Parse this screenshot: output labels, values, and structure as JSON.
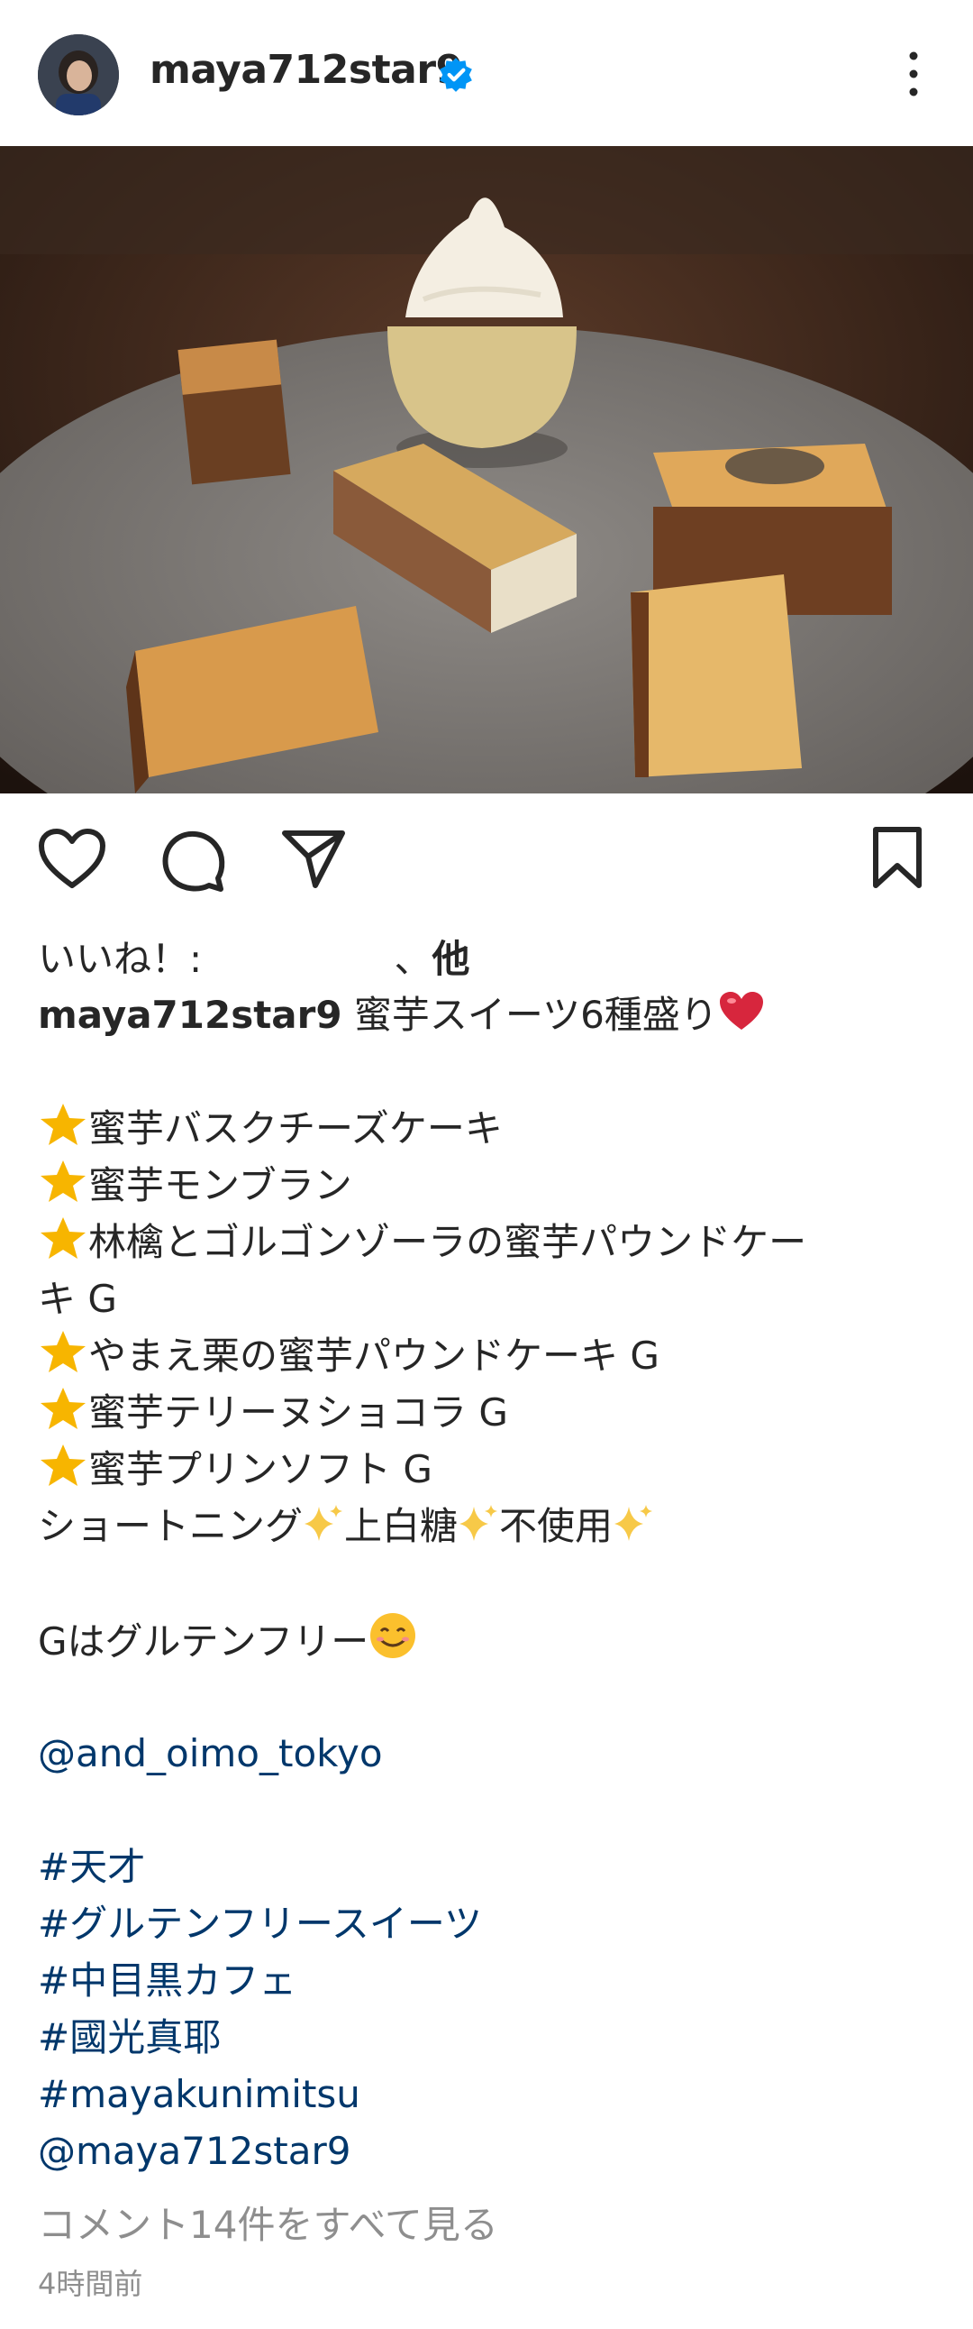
{
  "post": {
    "username": "maya712star9",
    "verified_badge_color": "#0095f6",
    "photo_alt_icon": "food-photo"
  },
  "actions": {
    "like_icon": "heart-icon",
    "comment_icon": "comment-icon",
    "share_icon": "send-icon",
    "save_icon": "bookmark-icon"
  },
  "likes": {
    "prefix": "いいね！: ",
    "separator": "、",
    "others": "他"
  },
  "caption": {
    "owner": "maya712star9",
    "title": "蜜芋スイーツ6種盛り",
    "items": [
      "蜜芋バスクチーズケーキ",
      "蜜芋モンブラン",
      "林檎とゴルゴンゾーラの蜜芋パウンドケー",
      "キ G",
      "やまえ栗の蜜芋パウンドケーキ G",
      "蜜芋テリーヌショコラ G",
      "蜜芋プリンソフト G"
    ],
    "shortening_parts": [
      "ショートニング",
      "上白糖",
      "不使用"
    ],
    "gluten_free": "Gはグルテンフリー",
    "mention_shop": "@and_oimo_tokyo",
    "hashtags": [
      "#天才",
      "#グルテンフリースイーツ",
      "#中目黒カフェ",
      "#國光真耶",
      "#mayakunimitsu"
    ],
    "mention_self": "@maya712star9"
  },
  "view_comments": "コメント14件をすべて見る",
  "timestamp": "4時間前",
  "colors": {
    "text": "#262626",
    "link": "#00376b",
    "muted": "#8e8e8e"
  }
}
